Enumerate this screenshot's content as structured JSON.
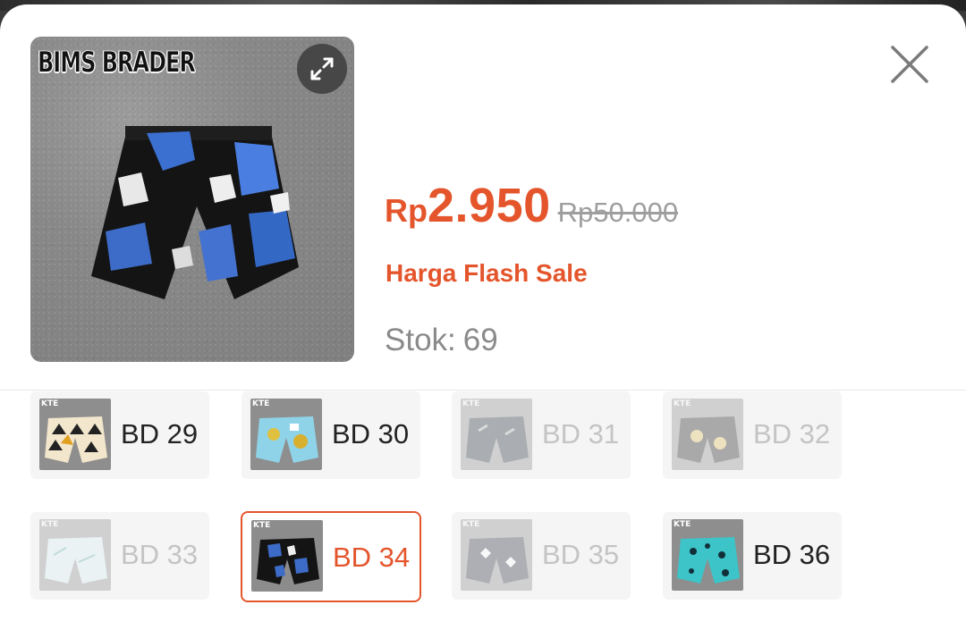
{
  "product": {
    "brand_logo": "BIMS BRADER",
    "price": {
      "currency": "Rp",
      "value": "2.950",
      "original": "Rp50.000"
    },
    "flash_label": "Harga Flash Sale",
    "stock": {
      "label": "Stok:",
      "count": "69"
    }
  },
  "icons": {
    "expand": "expand-icon",
    "close": "close-icon"
  },
  "colors": {
    "accent": "#e4552c",
    "muted": "#9e9e9e",
    "disabled": "#c4c4c4"
  },
  "variants": [
    {
      "label": "BD 29",
      "state": "available"
    },
    {
      "label": "BD 30",
      "state": "available"
    },
    {
      "label": "BD 31",
      "state": "disabled"
    },
    {
      "label": "BD 32",
      "state": "disabled"
    },
    {
      "label": "BD 33",
      "state": "disabled"
    },
    {
      "label": "BD 34",
      "state": "selected"
    },
    {
      "label": "BD 35",
      "state": "disabled"
    },
    {
      "label": "BD 36",
      "state": "available"
    }
  ]
}
